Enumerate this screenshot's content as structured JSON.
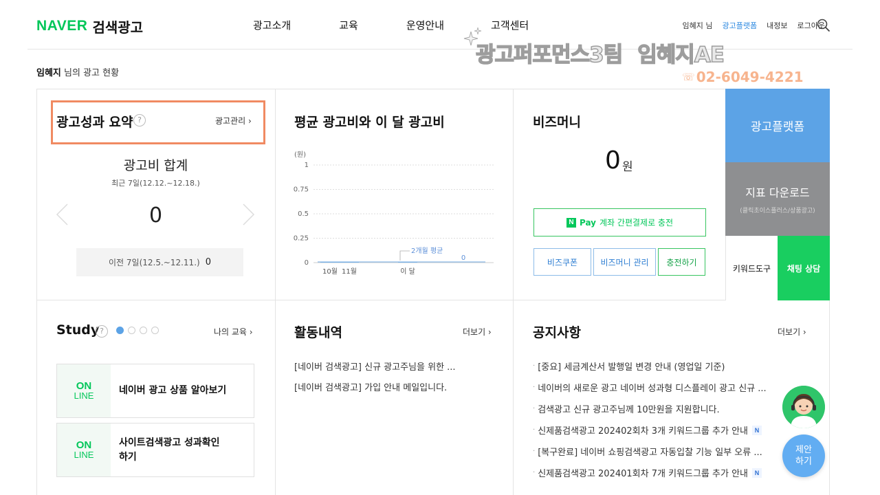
{
  "header": {
    "logo_brand": "NAVER",
    "logo_service": "검색광고",
    "menu": [
      "광고소개",
      "교육",
      "운영안내",
      "고객센터"
    ],
    "util": {
      "user": "임혜지 님",
      "platform": "광고플랫폼",
      "myinfo": "내정보",
      "logout": "로그아웃"
    }
  },
  "watermark": {
    "team": "광고퍼포먼스3팀",
    "name": "임혜지AE",
    "phone": "02-6049-4221",
    "phone_icon": "☏"
  },
  "greeting": {
    "name": "임혜지",
    "suffix": " 님의 광고 현황"
  },
  "summary": {
    "title": "광고성과 요약",
    "help": "?",
    "manage": "광고관리 ›",
    "sum_title": "광고비 합계",
    "period": "최근 7일(12.12.~12.18.)",
    "value": "0",
    "prev_label": "이전 7일(12.5.~12.11.)",
    "prev_value": "0"
  },
  "avg_chart": {
    "title": "평균 광고비와 이 달 광고비"
  },
  "chart_data": {
    "type": "bar",
    "title": "평균 광고비와 이 달 광고비",
    "y_unit": "(원)",
    "y_ticks": [
      "1",
      "0.75",
      "0.5",
      "0.25",
      "0"
    ],
    "ylim": [
      0,
      1
    ],
    "categories": [
      "10월",
      "11월",
      "이 달"
    ],
    "values": [
      0,
      0,
      0
    ],
    "avg_label": "2개월 평균",
    "current_label": "0",
    "grid": true
  },
  "bizmoney": {
    "title": "비즈머니",
    "value": "0",
    "unit": "원",
    "pay_n": "N",
    "pay_label": "Pay",
    "pay_text": "계좌 간편결제로 충전",
    "coupon": "비즈쿠폰",
    "manage": "비즈머니 관리",
    "charge": "충전하기"
  },
  "side": {
    "platform": "광고플랫폼",
    "download": "지표 다운로드",
    "download_sub": "(클릭초이스플러스/상품광고)",
    "keyword": "키워드도구",
    "chat": "채팅 상담"
  },
  "study": {
    "title": "Study",
    "help": "?",
    "my": "나의 교육 ›",
    "cards": [
      {
        "on": "ON",
        "line": "LINE",
        "text": "네이버 광고 상품 알아보기"
      },
      {
        "on": "ON",
        "line": "LINE",
        "text": "사이트검색광고 성과확인\n하기"
      }
    ]
  },
  "activity": {
    "title": "활동내역",
    "more": "더보기 ›",
    "items": [
      "[네이버 검색광고] 신규 광고주님을 위한 ...",
      "[네이버 검색광고] 가입 안내 메일입니다."
    ]
  },
  "notice": {
    "title": "공지사항",
    "more": "더보기 ›",
    "bullet": "·",
    "badge": "N",
    "items": [
      "[중요] 세금계산서 발행일 변경 안내 (영업일 기준)",
      "네이버의 새로운 광고 네이버 성과형 디스플레이 광고 신규 ...",
      "검색광고 신규 광고주님께 10만원을 지원합니다.",
      "신제품검색광고 202402회차 3개 키워드그룹 추가 안내",
      "[복구완료] 네이버 쇼핑검색광고 자동입찰 기능 일부 오류 ...",
      "신제품검색광고 202401회차 7개 키워드그룹 추가 안내"
    ]
  },
  "floating": {
    "suggest": "제안\n하기"
  }
}
